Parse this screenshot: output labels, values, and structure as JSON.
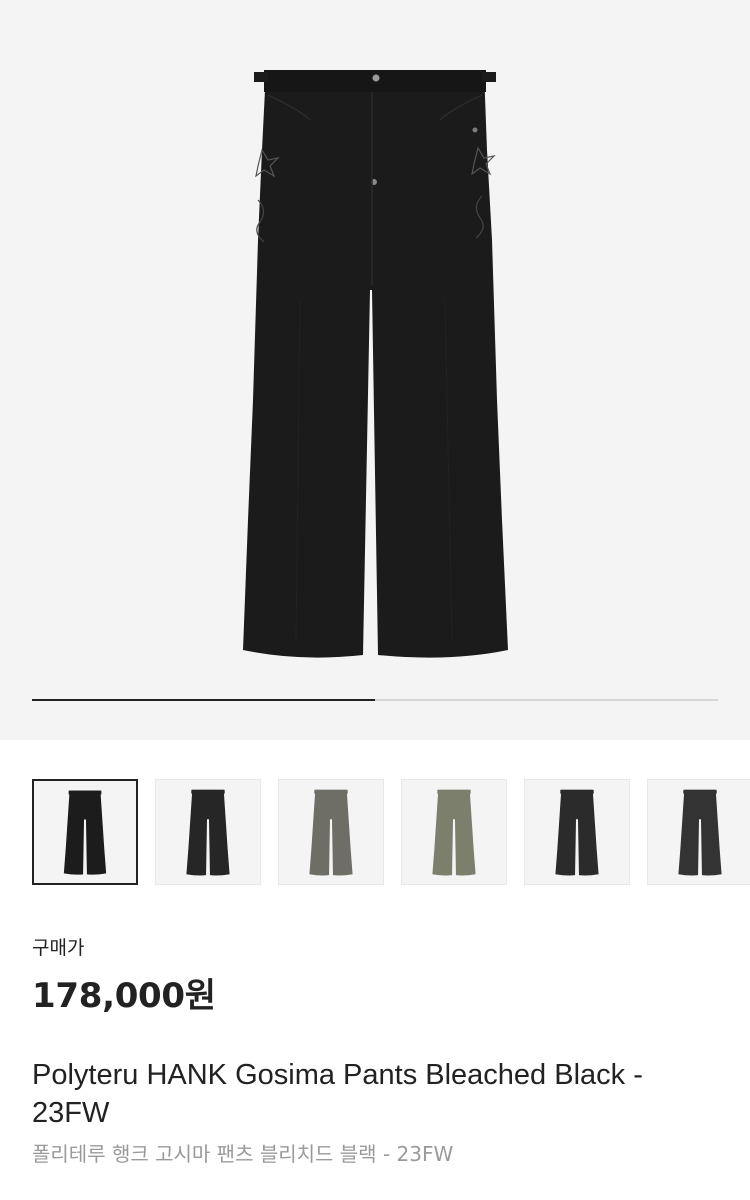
{
  "product": {
    "image_icon": "black-wide-pants-image",
    "carousel_progress": 0.5,
    "thumbnails": [
      {
        "color": "#1c1c1c",
        "selected": true
      },
      {
        "color": "#262626",
        "selected": false
      },
      {
        "color": "#6f6e66",
        "selected": false
      },
      {
        "color": "#7b7f6c",
        "selected": false
      },
      {
        "color": "#2b2b2b",
        "selected": false
      },
      {
        "color": "#333333",
        "selected": false
      }
    ],
    "price_label": "구매가",
    "price": "178,000원",
    "title_en": "Polyteru HANK Gosima Pants Bleached Black - 23FW",
    "title_ko": "폴리테루 행크 고시마 팬츠 블리치드 블랙 - 23FW"
  },
  "colors": {
    "hero_bg": "#f4f4f4",
    "pants_black": "#1b1b1b",
    "text_primary": "#222222",
    "text_secondary": "#9a9a9a",
    "progress_track": "#d6d6d6",
    "progress_fill": "#222222"
  }
}
